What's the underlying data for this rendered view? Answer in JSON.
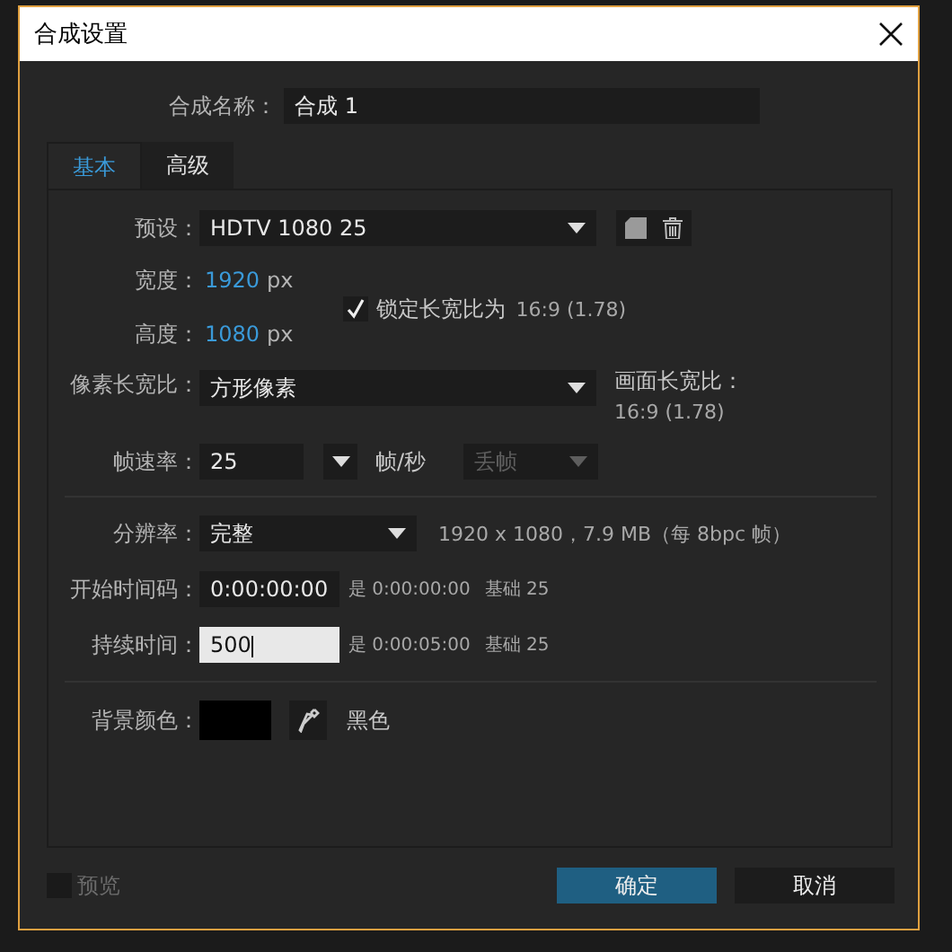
{
  "dialog": {
    "title": "合成设置"
  },
  "name": {
    "label": "合成名称：",
    "value": "合成 1"
  },
  "tabs": [
    {
      "label": "基本",
      "selected": true
    },
    {
      "label": "高级",
      "selected": false
    }
  ],
  "preset": {
    "label": "预设：",
    "value": "HDTV 1080 25"
  },
  "width": {
    "label": "宽度：",
    "value": "1920",
    "unit": "px"
  },
  "height": {
    "label": "高度：",
    "value": "1080",
    "unit": "px"
  },
  "lock_aspect": {
    "label": "锁定长宽比为",
    "checked": true,
    "ratio": "16:9 (1.78)"
  },
  "pixel_aspect": {
    "label": "像素长宽比：",
    "value": "方形像素"
  },
  "frame_aspect": {
    "label": "画面长宽比：",
    "value": "16:9 (1.78)"
  },
  "frame_rate": {
    "label": "帧速率：",
    "value": "25",
    "unit": "帧/秒",
    "drop_frame": {
      "value": "丢帧",
      "disabled": true
    }
  },
  "resolution": {
    "label": "分辨率：",
    "value": "完整",
    "info": "1920 x 1080，7.9 MB（每 8bpc 帧）"
  },
  "start_timecode": {
    "label": "开始时间码：",
    "value": "0:00:00:00",
    "equals": "是 0:00:00:00",
    "base": "基础 25",
    "focused": false
  },
  "duration": {
    "label": "持续时间：",
    "value": "500",
    "equals": "是 0:00:05:00",
    "base": "基础 25",
    "focused": true
  },
  "background_color": {
    "label": "背景颜色：",
    "color": "#000000",
    "name": "黑色"
  },
  "preview": {
    "label": "预览",
    "checked": false,
    "disabled": true
  },
  "buttons": [
    {
      "label": "确定",
      "kind": "primary"
    },
    {
      "label": "取消",
      "kind": "secondary"
    }
  ]
}
